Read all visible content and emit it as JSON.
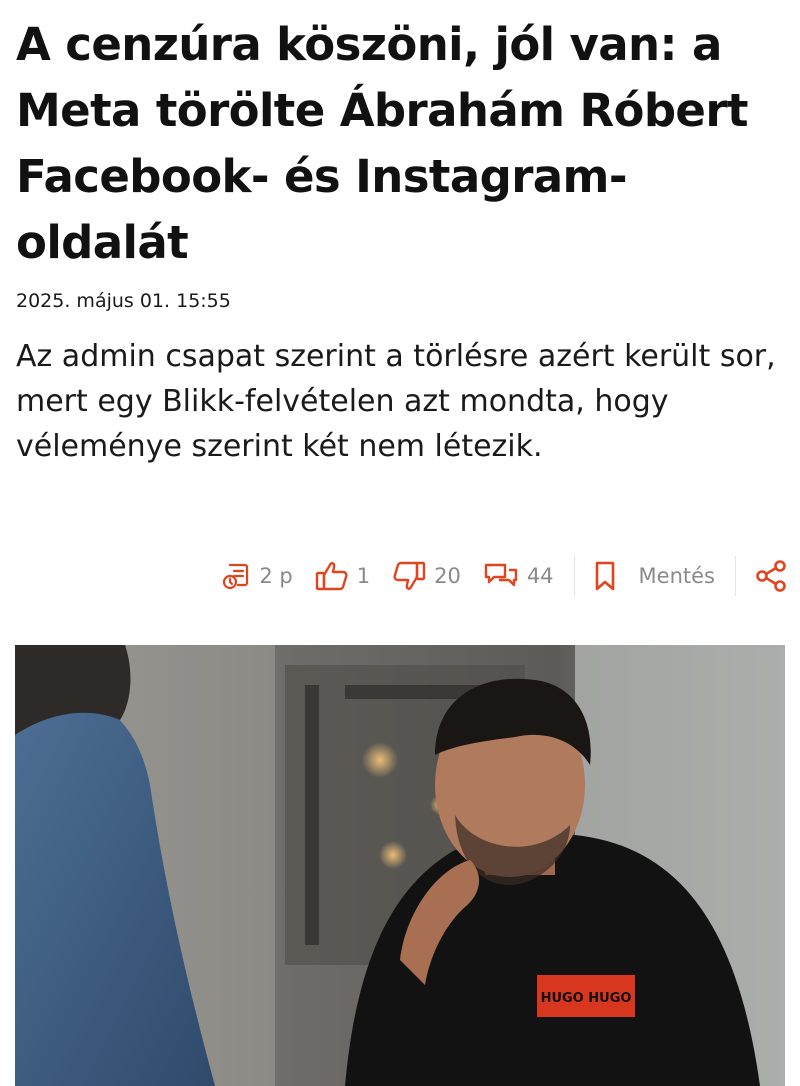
{
  "article": {
    "title": "A cenzúra köszöni, jól van: a Meta törölte Ábrahám Róbert Facebook- és Instagram-oldalát",
    "date": "2025. május 01. 15:55",
    "lead": "Az admin csapat szerint a törlésre azért került sor, mert egy Blikk-felvételen azt mondta, hogy véleménye szerint két nem létezik."
  },
  "toolbar": {
    "reading_time": "2 p",
    "likes": "1",
    "dislikes": "20",
    "comments": "44",
    "save_label": "Mentés",
    "icons": [
      "reading-time-icon",
      "thumbs-up-icon",
      "thumbs-down-icon",
      "comments-icon",
      "bookmark-icon",
      "share-icon"
    ]
  },
  "photo": {
    "shirt_logo_text": "HUGO HUGO"
  },
  "colors": {
    "accent": "#e0451f",
    "text": "#111111",
    "muted": "#8a8a8a"
  }
}
